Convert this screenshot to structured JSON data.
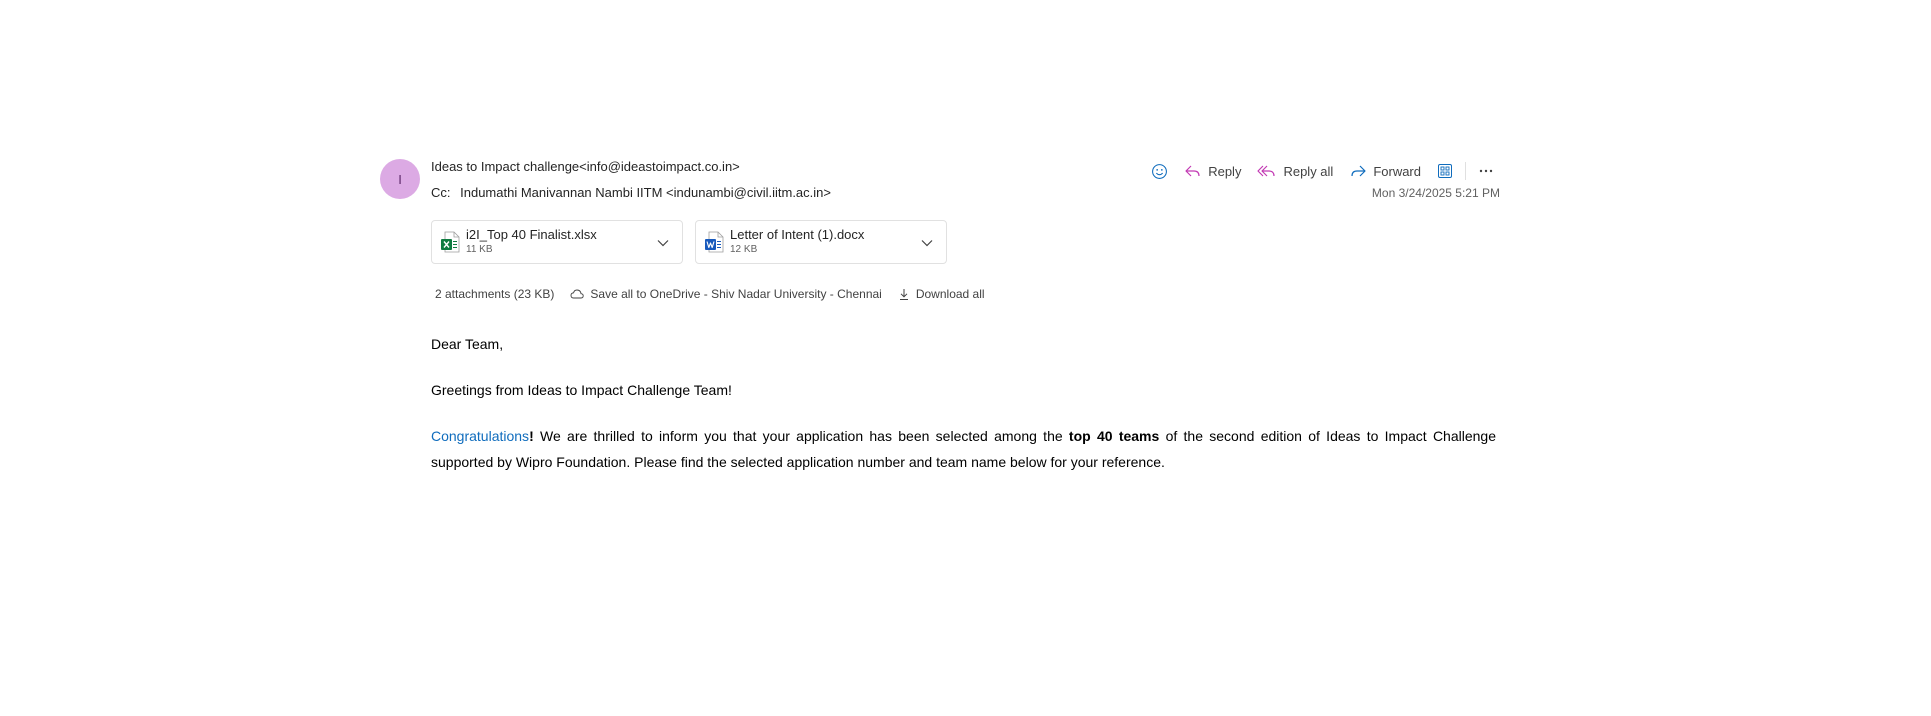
{
  "sender": {
    "avatar_initial": "I",
    "avatar_color": "#dcaae4",
    "from": "Ideas to Impact challenge<info@ideastoimpact.co.in>",
    "cc_label": "Cc:",
    "cc_value": "Indumathi Manivannan Nambi IITM <indunambi@civil.iitm.ac.in>"
  },
  "actions": {
    "emoji_icon": "smile-icon",
    "reply": "Reply",
    "reply_all": "Reply all",
    "forward": "Forward",
    "apps_icon": "apps-icon",
    "more_icon": "more-icon"
  },
  "date": "Mon 3/24/2025 5:21 PM",
  "attachments": [
    {
      "name": "i2I_Top 40 Finalist.xlsx",
      "size": "11 KB",
      "icon": "excel-file-icon",
      "color": "#107c41"
    },
    {
      "name": "Letter of Intent (1).docx",
      "size": "12 KB",
      "icon": "word-file-icon",
      "color": "#185abd"
    }
  ],
  "attachment_bar": {
    "count": "2 attachments (23 KB)",
    "save_all": "Save all to OneDrive - Shiv Nadar University - Chennai",
    "download_all": "Download all"
  },
  "body": {
    "greeting": "Dear Team,",
    "line2": "Greetings from Ideas to Impact Challenge Team!",
    "congrats": "Congratulations",
    "excl": "!",
    "para_part1": " We are thrilled to inform you that your application has been selected among the ",
    "para_bold": "top 40 teams",
    "para_part2": " of the second edition of Ideas to Impact Challenge supported by Wipro Foundation. Please find the selected application number and team name below for your reference."
  },
  "colors": {
    "accent": "#0f6cbd",
    "reply_icon": "#c239b3",
    "forward_icon": "#0f6cbd"
  }
}
